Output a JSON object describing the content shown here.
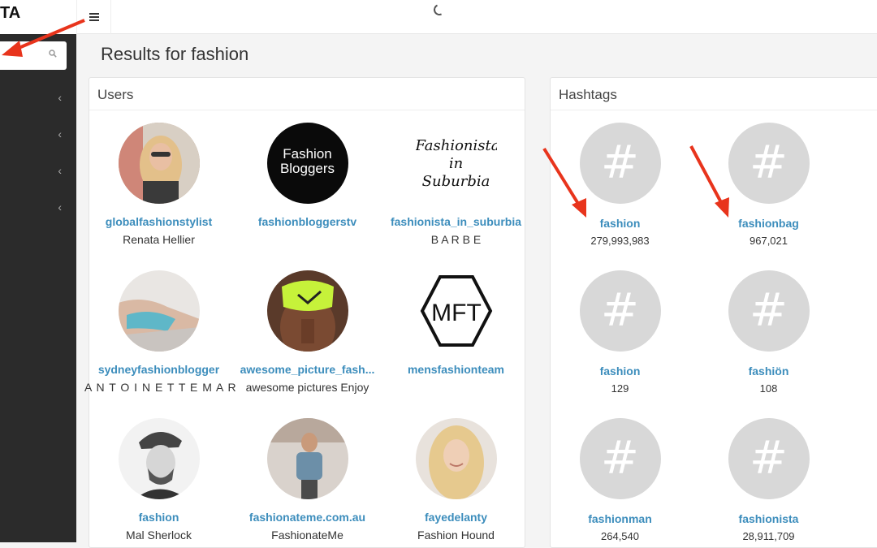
{
  "header": {
    "brand": "TA",
    "menu_icon": "hamburger-icon",
    "loading_icon": "spinner-icon"
  },
  "sidebar": {
    "search_placeholder": "",
    "search_icon": "search-icon",
    "items": [
      {
        "icon": "chevron-left-icon",
        "glyph": "‹"
      },
      {
        "icon": "chevron-left-icon",
        "glyph": "‹"
      },
      {
        "icon": "chevron-left-icon",
        "glyph": "‹"
      },
      {
        "icon": "chevron-left-icon",
        "glyph": "‹"
      }
    ]
  },
  "page": {
    "title": "Results for fashion"
  },
  "users_panel": {
    "title": "Users",
    "users": [
      {
        "username": "globalfashionstylist",
        "fullname": "Renata Hellier"
      },
      {
        "username": "fashionbloggerstv",
        "fullname": "",
        "avatar_text_1": "Fashion",
        "avatar_text_2": "Bloggers"
      },
      {
        "username": "fashionista_in_suburbia",
        "fullname": "B A R B E",
        "avatar_text_1": "Fashionista",
        "avatar_text_2": "in",
        "avatar_text_3": "Suburbia"
      },
      {
        "username": "sydneyfashionblogger",
        "fullname": "A N T O I N E T T E M A R"
      },
      {
        "username": "awesome_picture_fash...",
        "fullname": "awesome pictures Enjoy"
      },
      {
        "username": "mensfashionteam",
        "fullname": "",
        "avatar_text_1": "MFT"
      },
      {
        "username": "fashion",
        "fullname": "Mal Sherlock"
      },
      {
        "username": "fashionateme.com.au",
        "fullname": "FashionateMe"
      },
      {
        "username": "fayedelanty",
        "fullname": "Fashion Hound"
      }
    ]
  },
  "hashtags_panel": {
    "title": "Hashtags",
    "symbol": "#",
    "tags": [
      {
        "name": "fashion",
        "count": "279,993,983"
      },
      {
        "name": "fashionbag",
        "count": "967,021"
      },
      {
        "name": "fashion",
        "count": "129"
      },
      {
        "name": "fashiön",
        "count": "108"
      },
      {
        "name": "fashionman",
        "count": "264,540"
      },
      {
        "name": "fashionista",
        "count": "28,911,709"
      }
    ]
  },
  "colors": {
    "link": "#3c8dbc",
    "sidebar": "#2b2b2b",
    "annotation_arrow": "#e8341c",
    "hashtag_circle": "#d8d8d8"
  }
}
